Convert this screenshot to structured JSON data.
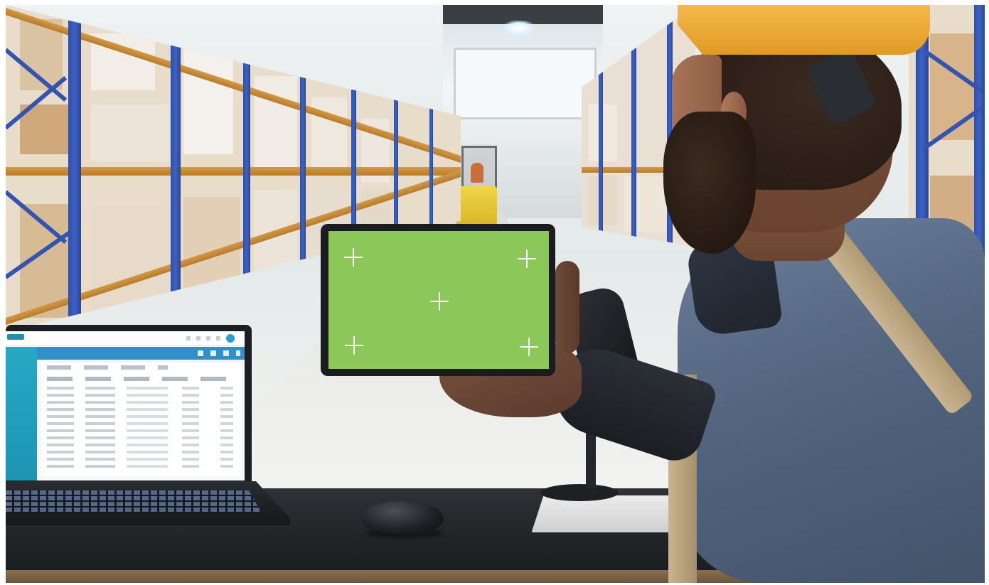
{
  "scene": {
    "description_visible_text": [],
    "colors": {
      "rack_blue": "#3454b0",
      "beam_orange": "#c88a38",
      "tablet_green": "#8cc75a",
      "hardhat_orange": "#f0ab36",
      "shirt_blue": "#5a6d88",
      "dashboard_blue": "#3190c8",
      "dashboard_teal": "#26a9c4"
    }
  },
  "icons": {
    "tablet_markers": [
      "crosshair-icon",
      "crosshair-icon",
      "crosshair-icon",
      "crosshair-icon",
      "crosshair-icon"
    ]
  }
}
